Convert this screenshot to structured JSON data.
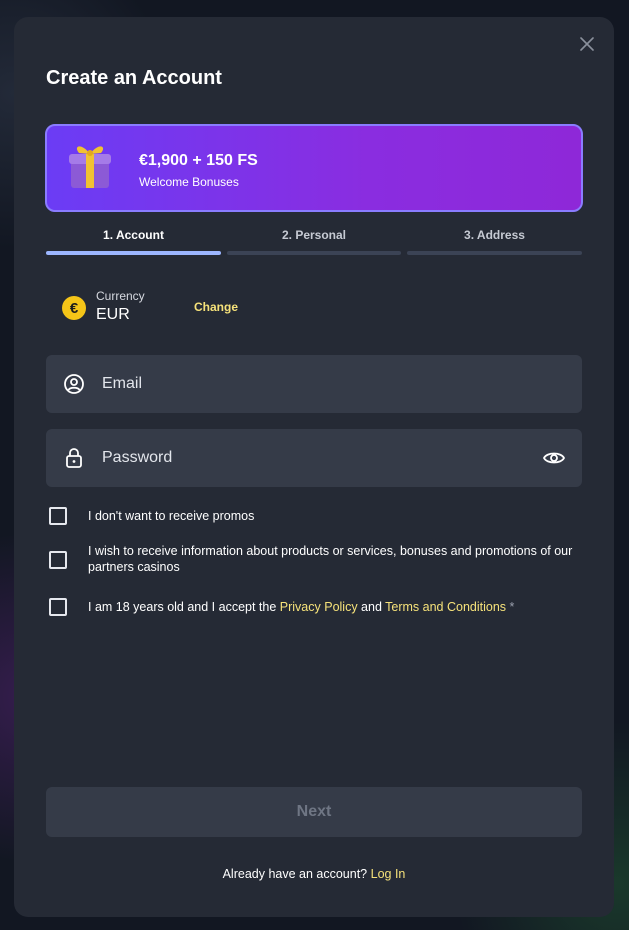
{
  "modal": {
    "title": "Create an Account"
  },
  "banner": {
    "amount": "€1,900 + 150 FS",
    "subtitle": "Welcome Bonuses"
  },
  "steps": [
    {
      "label": "1.  Account",
      "active": true
    },
    {
      "label": "2.  Personal",
      "active": false
    },
    {
      "label": "3.  Address",
      "active": false
    }
  ],
  "currency": {
    "caption": "Currency",
    "value": "EUR",
    "symbol": "€",
    "change_label": "Change"
  },
  "fields": {
    "email": {
      "placeholder": "Email",
      "value": ""
    },
    "password": {
      "placeholder": "Password",
      "value": ""
    }
  },
  "checkboxes": {
    "promos": {
      "text": "I don't want to receive promos",
      "checked": false
    },
    "partners": {
      "text": "I wish to receive information about products or services, bonuses and promotions of our partners casinos",
      "checked": false
    },
    "age": {
      "prefix": "I am 18 years old and I accept the ",
      "privacy_link": "Privacy Policy",
      "middle": " and ",
      "terms_link": "Terms and Conditions",
      "required_marker": " *",
      "checked": false
    }
  },
  "footer": {
    "next_label": "Next",
    "login_prompt": "Already have an account? ",
    "login_link": "Log In"
  },
  "colors": {
    "accent_yellow": "#f6e27a",
    "active_step": "#9cb6ff",
    "banner_start": "#6b3cf5",
    "banner_end": "#8e28d8"
  }
}
